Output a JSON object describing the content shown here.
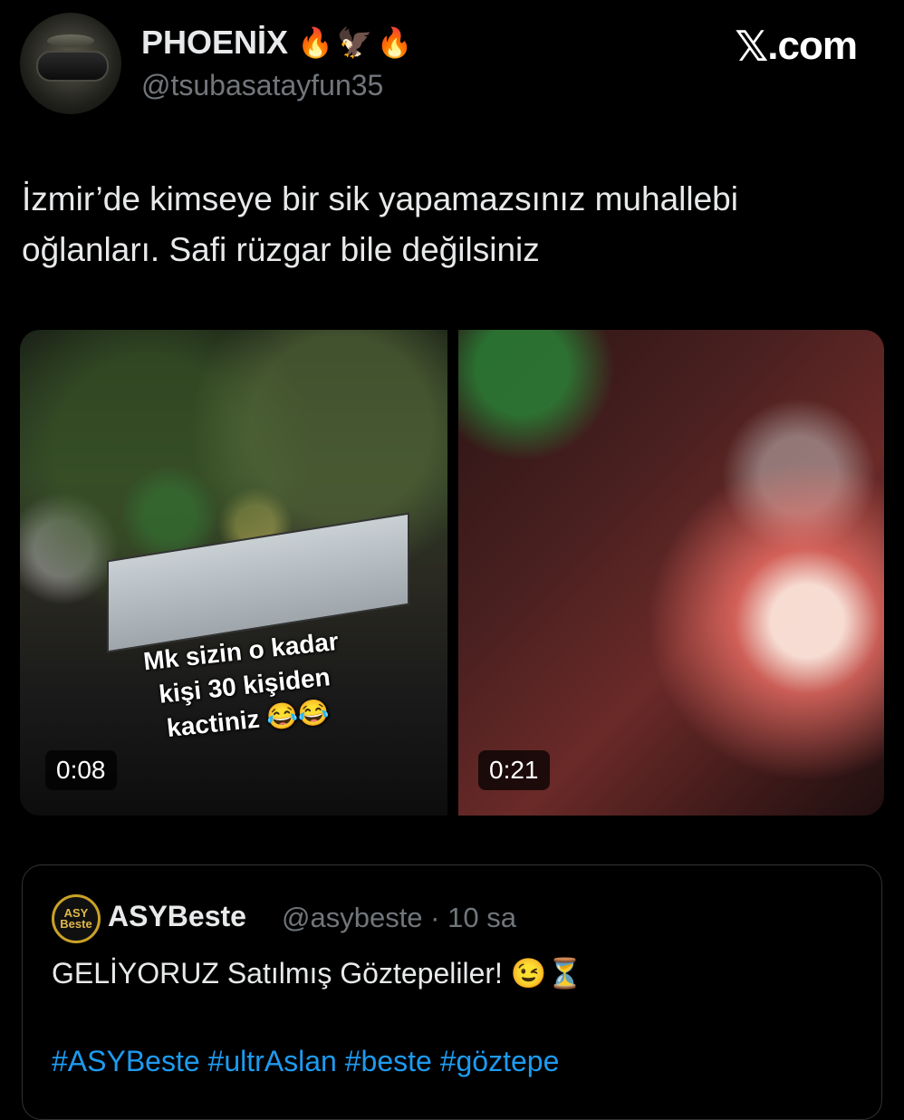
{
  "author": {
    "display_name": "PHOENİX",
    "name_emojis": [
      "🔥",
      "🦅",
      "🔥"
    ],
    "handle": "@tsubasatayfun35",
    "avatar_icon": "helmet-avatar"
  },
  "brand": {
    "logo_glyph": "𝕏",
    "domain": ".com"
  },
  "tweet": {
    "lines": [
      "İzmir’de kimseye bir sik yapamazsınız muhallebi",
      "oğlanları. Safi rüzgar bile değilsiniz"
    ]
  },
  "media": [
    {
      "overlay_lines": [
        "Mk sizin o kadar",
        "kişi 30 kişiden",
        "kactiniz 😂😂"
      ],
      "duration": "0:08"
    },
    {
      "duration": "0:21"
    }
  ],
  "quoted": {
    "avatar_text": "ASY Beste",
    "name": "ASYBeste",
    "handle": "@asybeste",
    "separator": "·",
    "time": "10 sa",
    "text": "GELİYORUZ Satılmış Göztepeliler! 😉⏳",
    "hashtags": "#ASYBeste #ultrAslan #beste #göztepe"
  },
  "colors": {
    "background": "#000000",
    "text": "#e7e9ea",
    "secondary_text": "#71767b",
    "link": "#1d9bf0",
    "border": "#2f3336"
  }
}
